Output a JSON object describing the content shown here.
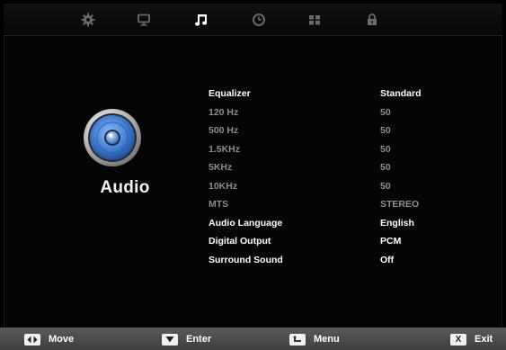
{
  "section": {
    "title": "Audio",
    "icon": "speaker-icon"
  },
  "tabs": [
    {
      "icon": "gear-icon",
      "active": false
    },
    {
      "icon": "monitor-icon",
      "active": false
    },
    {
      "icon": "music-note-icon",
      "active": true
    },
    {
      "icon": "clock-icon",
      "active": false
    },
    {
      "icon": "grid-icon",
      "active": false
    },
    {
      "icon": "lock-icon",
      "active": false
    }
  ],
  "menu": {
    "items": [
      {
        "label": "Equalizer",
        "value": "Standard",
        "enabled": true
      },
      {
        "label": "120 Hz",
        "value": "50",
        "enabled": false
      },
      {
        "label": "500 Hz",
        "value": "50",
        "enabled": false
      },
      {
        "label": "1.5KHz",
        "value": "50",
        "enabled": false
      },
      {
        "label": "5KHz",
        "value": "50",
        "enabled": false
      },
      {
        "label": "10KHz",
        "value": "50",
        "enabled": false
      },
      {
        "label": "MTS",
        "value": "STEREO",
        "enabled": false
      },
      {
        "label": "Audio Language",
        "value": "English",
        "enabled": true
      },
      {
        "label": "Digital Output",
        "value": "PCM",
        "enabled": true
      },
      {
        "label": "Surround Sound",
        "value": "Off",
        "enabled": true
      }
    ]
  },
  "hints": {
    "move": {
      "label": "Move",
      "key_icon": "left-right-arrows-icon"
    },
    "enter": {
      "label": "Enter",
      "key_icon": "down-arrow-icon"
    },
    "menu": {
      "label": "Menu",
      "key_icon": "return-arrow-icon"
    },
    "exit": {
      "label": "Exit",
      "key_icon": "x-key-icon",
      "key_text": "X"
    }
  },
  "colors": {
    "active_text": "#ffffff",
    "disabled_text": "#8d8d8d",
    "active_tab": "#ffffff",
    "inactive_tab": "#6a6a6a",
    "speaker_blue": "#4a86d8"
  }
}
